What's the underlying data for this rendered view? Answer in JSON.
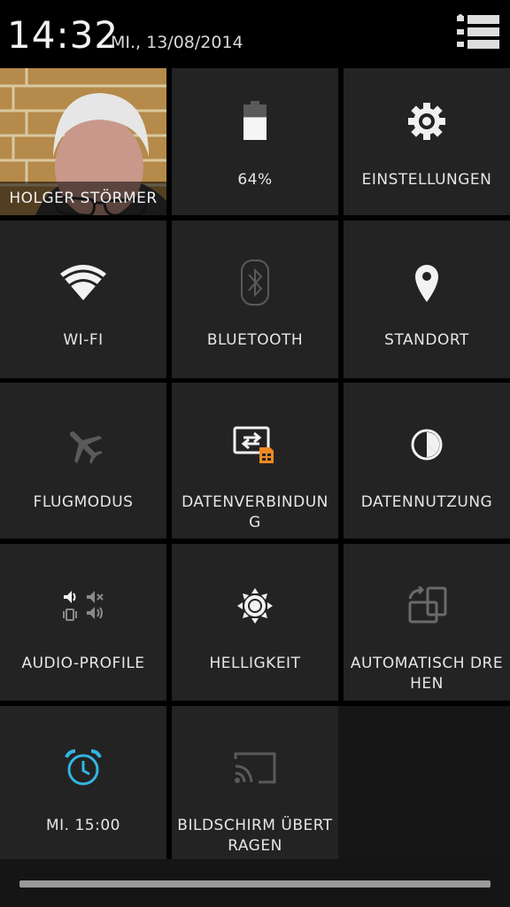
{
  "status": {
    "time": "14:32",
    "date": "MI., 13/08/2014"
  },
  "tiles": {
    "profile": {
      "name": "HOLGER STÖRMER",
      "icon": "profile-photo"
    },
    "battery": {
      "label": "64%",
      "level_percent": 64,
      "icon": "battery-icon"
    },
    "settings": {
      "label": "EINSTELLUNGEN",
      "icon": "gear-icon"
    },
    "wifi": {
      "label": "WI-FI",
      "icon": "wifi-icon"
    },
    "bluetooth": {
      "label": "BLUETOOTH",
      "icon": "bluetooth-icon"
    },
    "location": {
      "label": "STANDORT",
      "icon": "location-pin-icon"
    },
    "airplane": {
      "label": "FLUGMODUS",
      "icon": "airplane-icon"
    },
    "data_connection": {
      "label": "DATENVERBINDUNG",
      "icon": "data-connection-icon"
    },
    "data_usage": {
      "label": "DATENNUTZUNG",
      "icon": "data-usage-icon"
    },
    "audio_profiles": {
      "label": "AUDIO-PROFILE",
      "icon": "audio-profiles-icon"
    },
    "brightness": {
      "label": "HELLIGKEIT",
      "icon": "brightness-icon"
    },
    "auto_rotate": {
      "label": "AUTOMATISCH DREHEN",
      "icon": "auto-rotate-icon"
    },
    "alarm": {
      "label": "MI. 15:00",
      "icon": "alarm-clock-icon"
    },
    "cast_screen": {
      "label": "BILDSCHIRM ÜBERTRAGEN",
      "icon": "cast-screen-icon"
    }
  },
  "colors": {
    "tile_bg": "#232323",
    "accent_blue": "#33b5e5",
    "sim_orange": "#f08a24",
    "disabled_icon": "#5a5a5a"
  }
}
